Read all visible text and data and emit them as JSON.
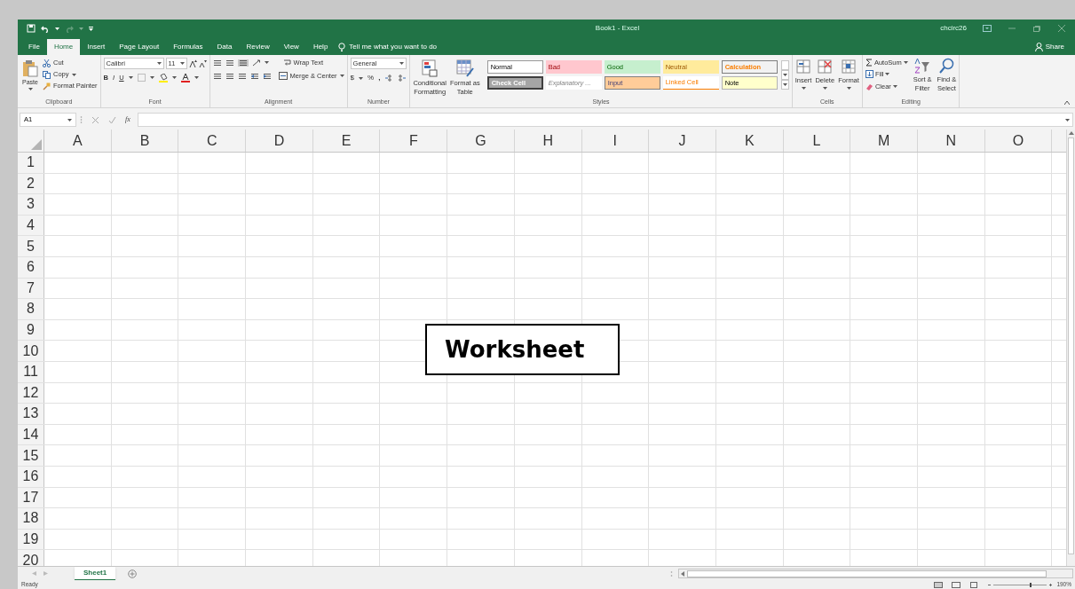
{
  "window": {
    "title": "Book1  -  Excel",
    "user": "chcirc26"
  },
  "tabs": [
    {
      "label": "File",
      "selected": false
    },
    {
      "label": "Home",
      "selected": true
    },
    {
      "label": "Insert",
      "selected": false
    },
    {
      "label": "Page Layout",
      "selected": false
    },
    {
      "label": "Formulas",
      "selected": false
    },
    {
      "label": "Data",
      "selected": false
    },
    {
      "label": "Review",
      "selected": false
    },
    {
      "label": "View",
      "selected": false
    },
    {
      "label": "Help",
      "selected": false
    }
  ],
  "tell_me": "Tell me what you want to do",
  "share": "Share",
  "clipboard": {
    "label": "Clipboard",
    "paste": "Paste",
    "cut": "Cut",
    "copy": "Copy",
    "format_painter": "Format Painter"
  },
  "font": {
    "label": "Font",
    "name": "Calibri",
    "size": "11",
    "styles": [
      "B",
      "I",
      "U"
    ]
  },
  "alignment": {
    "label": "Alignment",
    "wrap": "Wrap Text",
    "merge": "Merge & Center"
  },
  "number": {
    "label": "Number",
    "format": "General",
    "currency": "$",
    "percent": "%",
    "comma": ","
  },
  "styles": {
    "label": "Styles",
    "buttons": [
      {
        "lines": [
          "Conditional",
          "Formatting"
        ],
        "kind": "conditional"
      },
      {
        "lines": [
          "Format as",
          "Table"
        ],
        "kind": "table"
      }
    ],
    "cells": [
      {
        "label": "Normal",
        "kind": "normal"
      },
      {
        "label": "Bad",
        "kind": "bad"
      },
      {
        "label": "Good",
        "kind": "good"
      },
      {
        "label": "Neutral",
        "kind": "neutral"
      },
      {
        "label": "Calculation",
        "kind": "calculation"
      },
      {
        "label": "Check Cell",
        "kind": "check"
      },
      {
        "label": "Explanatory ...",
        "kind": "explanatory"
      },
      {
        "label": "Input",
        "kind": "input"
      },
      {
        "label": "Linked Cell",
        "kind": "linked"
      },
      {
        "label": "Note",
        "kind": "note"
      }
    ]
  },
  "cells_group": {
    "label": "Cells",
    "buttons": [
      {
        "label": "Insert",
        "kind": "insert"
      },
      {
        "label": "Delete",
        "kind": "delete"
      },
      {
        "label": "Format",
        "kind": "format"
      }
    ]
  },
  "editing": {
    "label": "Editing",
    "autosum": "AutoSum",
    "fill": "Fill",
    "clear": "Clear",
    "sort": [
      "Sort &",
      "Filter"
    ],
    "find": [
      "Find &",
      "Select"
    ]
  },
  "formula_bar": {
    "name_box": "A1",
    "fx": "fx"
  },
  "columns": [
    "A",
    "B",
    "C",
    "D",
    "E",
    "F",
    "G",
    "H",
    "I",
    "J",
    "K",
    "L",
    "M",
    "N",
    "O"
  ],
  "rows": [
    "1",
    "2",
    "3",
    "4",
    "5",
    "6",
    "7",
    "8",
    "9",
    "10",
    "11",
    "12",
    "13",
    "14",
    "15",
    "16",
    "17",
    "18",
    "19",
    "20"
  ],
  "callout": "Worksheet",
  "sheet_tabs": [
    {
      "label": "Sheet1",
      "selected": true
    }
  ],
  "status_bar": {
    "text": "Ready",
    "zoom": "190%"
  }
}
